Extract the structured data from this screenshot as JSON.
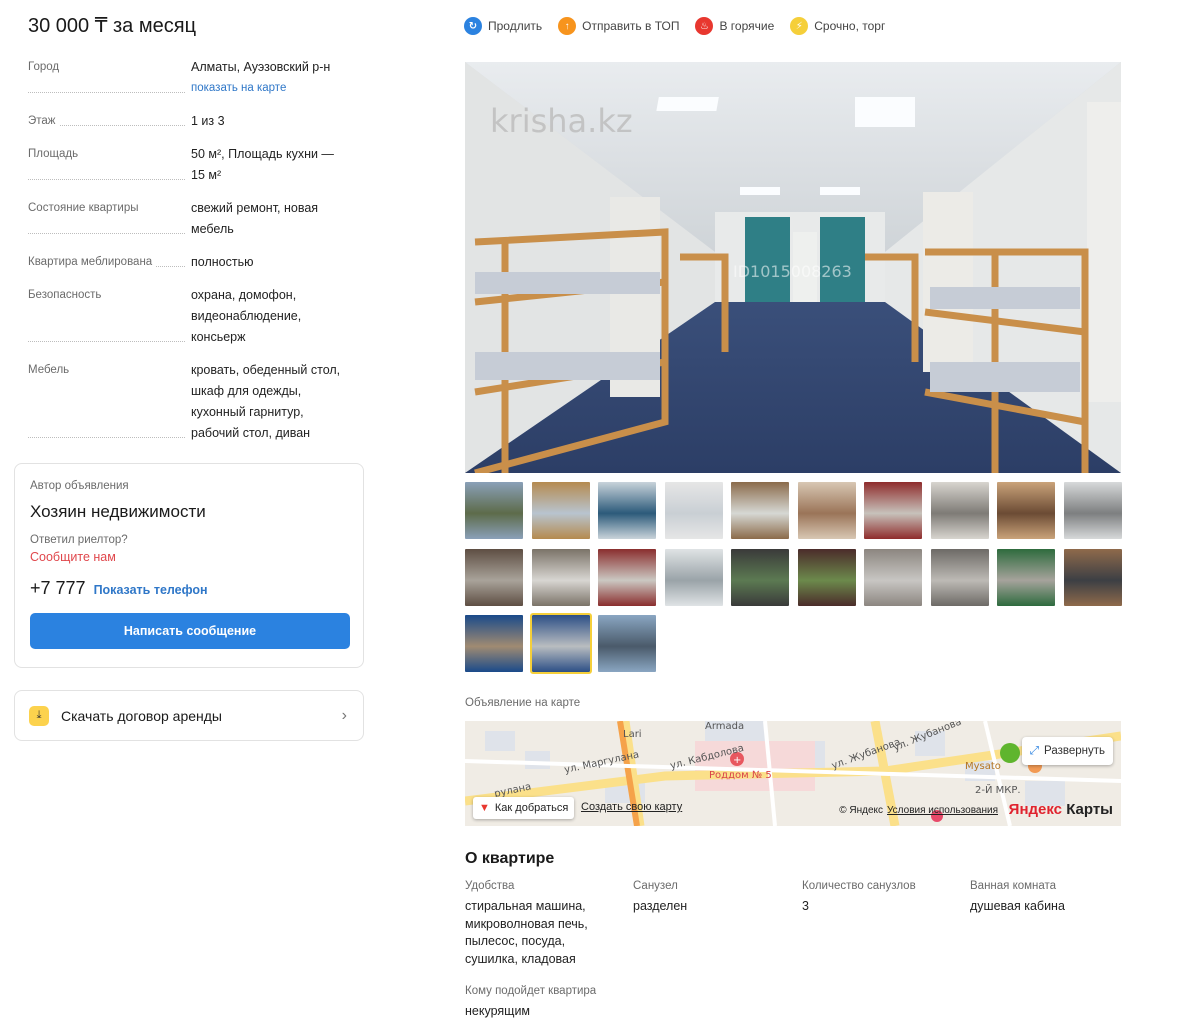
{
  "price": "30 000 ₸ за месяц",
  "properties": [
    {
      "key": "Город",
      "value": "Алматы, Ауэзовский р-н",
      "link": "показать на карте"
    },
    {
      "key": "Этаж",
      "value": "1 из 3"
    },
    {
      "key": "Площадь",
      "value": "50 м², Площадь кухни — 15 м²"
    },
    {
      "key": "Состояние квартиры",
      "value": "свежий ремонт, новая мебель"
    },
    {
      "key": "Квартира меблирована",
      "value": "полностью"
    },
    {
      "key": "Безопасность",
      "value": "охрана, домофон, видеонаблюдение, консьерж"
    },
    {
      "key": "Мебель",
      "value": "кровать, обеденный стол, шкаф для одежды, кухонный гарнитур, рабочий стол, диван"
    }
  ],
  "author": {
    "label": "Автор объявления",
    "name": "Хозяин недвижимости",
    "question": "Ответил риелтор?",
    "tell_us": "Сообщите нам",
    "phone": "+7 777",
    "show_phone": "Показать телефон",
    "message_button": "Написать сообщение"
  },
  "contract": {
    "label": "Скачать договор аренды",
    "icon": "download-icon"
  },
  "actions": [
    {
      "label": "Продлить",
      "icon": "refresh-icon",
      "color": "#2b82e0"
    },
    {
      "label": "Отправить в ТОП",
      "icon": "arrow-up-icon",
      "color": "#f7941d"
    },
    {
      "label": "В горячие",
      "icon": "fire-icon",
      "color": "#e8372f"
    },
    {
      "label": "Срочно, торг",
      "icon": "lightning-icon",
      "color": "#f5cf3a"
    }
  ],
  "photo": {
    "watermark": "krisha.kz",
    "id_mark": "ID1015008263"
  },
  "thumbnails": [
    {
      "tone": "#5d6b4a",
      "accent": "#8aa0b8"
    },
    {
      "tone": "#b8c4cf",
      "accent": "#b58a4f"
    },
    {
      "tone": "#2c5a7a",
      "accent": "#c9d3da"
    },
    {
      "tone": "#c9cfd4",
      "accent": "#e6e6e6"
    },
    {
      "tone": "#d6d8d4",
      "accent": "#8b6b4a"
    },
    {
      "tone": "#9a7458",
      "accent": "#d8c7b3"
    },
    {
      "tone": "#c7c2bb",
      "accent": "#8f2c2c"
    },
    {
      "tone": "#7e7b76",
      "accent": "#d8d5cf"
    },
    {
      "tone": "#6b4b34",
      "accent": "#caa37a"
    },
    {
      "tone": "#7d7f80",
      "accent": "#d7d9da"
    },
    {
      "tone": "#a9a39a",
      "accent": "#5e4e43"
    },
    {
      "tone": "#d8d6d2",
      "accent": "#7b7368"
    },
    {
      "tone": "#cbc8c2",
      "accent": "#8a2e2e"
    },
    {
      "tone": "#9aa3a8",
      "accent": "#dfe3e5"
    },
    {
      "tone": "#5c7a52",
      "accent": "#3a3a3a"
    },
    {
      "tone": "#6c8a4c",
      "accent": "#4b2c2a"
    },
    {
      "tone": "#c8c6c3",
      "accent": "#8c8680"
    },
    {
      "tone": "#bdbab5",
      "accent": "#6d6a66"
    },
    {
      "tone": "#a6a39c",
      "accent": "#2e6b3e"
    },
    {
      "tone": "#3c3f44",
      "accent": "#8f6a4b"
    },
    {
      "tone": "#a08b72",
      "accent": "#1a4a8a"
    },
    {
      "tone": "#b9bdc0",
      "accent": "#2c4f86"
    },
    {
      "tone": "#4a5a6a",
      "accent": "#8aa6c2"
    }
  ],
  "map": {
    "label": "Объявление на карте",
    "expand": "Развернуть",
    "route": "Как добраться",
    "create_map": "Создать свою карту",
    "copyright": "© Яндекс",
    "terms": "Условия использования",
    "brand_y": "Яндекс",
    "brand_maps": "Карты",
    "streets": [
      "ул. Маргулана",
      "ул. Кабдолова",
      "ул. Жубанова",
      "Armada",
      "Lari",
      "Роддом № 5",
      "Mysato",
      "2-Й МКР.",
      "рулана"
    ]
  },
  "about": {
    "title": "О квартире",
    "items": [
      {
        "key": "Удобства",
        "value": "стиральная машина, микроволновая печь, пылесос, посуда, сушилка, кладовая"
      },
      {
        "key": "Санузел",
        "value": "разделен"
      },
      {
        "key": "Количество санузлов",
        "value": "3"
      },
      {
        "key": "Ванная комната",
        "value": "душевая кабина"
      },
      {
        "key": "Кому подойдет квартира",
        "value": "некурящим"
      }
    ]
  }
}
